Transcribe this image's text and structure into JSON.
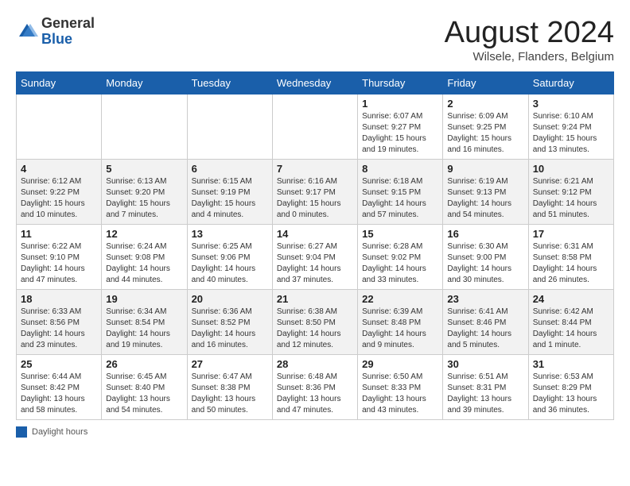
{
  "header": {
    "logo_general": "General",
    "logo_blue": "Blue",
    "month_title": "August 2024",
    "location": "Wilsele, Flanders, Belgium"
  },
  "weekdays": [
    "Sunday",
    "Monday",
    "Tuesday",
    "Wednesday",
    "Thursday",
    "Friday",
    "Saturday"
  ],
  "footer": {
    "label": "Daylight hours"
  },
  "weeks": [
    [
      {
        "day": "",
        "info": ""
      },
      {
        "day": "",
        "info": ""
      },
      {
        "day": "",
        "info": ""
      },
      {
        "day": "",
        "info": ""
      },
      {
        "day": "1",
        "info": "Sunrise: 6:07 AM\nSunset: 9:27 PM\nDaylight: 15 hours\nand 19 minutes."
      },
      {
        "day": "2",
        "info": "Sunrise: 6:09 AM\nSunset: 9:25 PM\nDaylight: 15 hours\nand 16 minutes."
      },
      {
        "day": "3",
        "info": "Sunrise: 6:10 AM\nSunset: 9:24 PM\nDaylight: 15 hours\nand 13 minutes."
      }
    ],
    [
      {
        "day": "4",
        "info": "Sunrise: 6:12 AM\nSunset: 9:22 PM\nDaylight: 15 hours\nand 10 minutes."
      },
      {
        "day": "5",
        "info": "Sunrise: 6:13 AM\nSunset: 9:20 PM\nDaylight: 15 hours\nand 7 minutes."
      },
      {
        "day": "6",
        "info": "Sunrise: 6:15 AM\nSunset: 9:19 PM\nDaylight: 15 hours\nand 4 minutes."
      },
      {
        "day": "7",
        "info": "Sunrise: 6:16 AM\nSunset: 9:17 PM\nDaylight: 15 hours\nand 0 minutes."
      },
      {
        "day": "8",
        "info": "Sunrise: 6:18 AM\nSunset: 9:15 PM\nDaylight: 14 hours\nand 57 minutes."
      },
      {
        "day": "9",
        "info": "Sunrise: 6:19 AM\nSunset: 9:13 PM\nDaylight: 14 hours\nand 54 minutes."
      },
      {
        "day": "10",
        "info": "Sunrise: 6:21 AM\nSunset: 9:12 PM\nDaylight: 14 hours\nand 51 minutes."
      }
    ],
    [
      {
        "day": "11",
        "info": "Sunrise: 6:22 AM\nSunset: 9:10 PM\nDaylight: 14 hours\nand 47 minutes."
      },
      {
        "day": "12",
        "info": "Sunrise: 6:24 AM\nSunset: 9:08 PM\nDaylight: 14 hours\nand 44 minutes."
      },
      {
        "day": "13",
        "info": "Sunrise: 6:25 AM\nSunset: 9:06 PM\nDaylight: 14 hours\nand 40 minutes."
      },
      {
        "day": "14",
        "info": "Sunrise: 6:27 AM\nSunset: 9:04 PM\nDaylight: 14 hours\nand 37 minutes."
      },
      {
        "day": "15",
        "info": "Sunrise: 6:28 AM\nSunset: 9:02 PM\nDaylight: 14 hours\nand 33 minutes."
      },
      {
        "day": "16",
        "info": "Sunrise: 6:30 AM\nSunset: 9:00 PM\nDaylight: 14 hours\nand 30 minutes."
      },
      {
        "day": "17",
        "info": "Sunrise: 6:31 AM\nSunset: 8:58 PM\nDaylight: 14 hours\nand 26 minutes."
      }
    ],
    [
      {
        "day": "18",
        "info": "Sunrise: 6:33 AM\nSunset: 8:56 PM\nDaylight: 14 hours\nand 23 minutes."
      },
      {
        "day": "19",
        "info": "Sunrise: 6:34 AM\nSunset: 8:54 PM\nDaylight: 14 hours\nand 19 minutes."
      },
      {
        "day": "20",
        "info": "Sunrise: 6:36 AM\nSunset: 8:52 PM\nDaylight: 14 hours\nand 16 minutes."
      },
      {
        "day": "21",
        "info": "Sunrise: 6:38 AM\nSunset: 8:50 PM\nDaylight: 14 hours\nand 12 minutes."
      },
      {
        "day": "22",
        "info": "Sunrise: 6:39 AM\nSunset: 8:48 PM\nDaylight: 14 hours\nand 9 minutes."
      },
      {
        "day": "23",
        "info": "Sunrise: 6:41 AM\nSunset: 8:46 PM\nDaylight: 14 hours\nand 5 minutes."
      },
      {
        "day": "24",
        "info": "Sunrise: 6:42 AM\nSunset: 8:44 PM\nDaylight: 14 hours\nand 1 minute."
      }
    ],
    [
      {
        "day": "25",
        "info": "Sunrise: 6:44 AM\nSunset: 8:42 PM\nDaylight: 13 hours\nand 58 minutes."
      },
      {
        "day": "26",
        "info": "Sunrise: 6:45 AM\nSunset: 8:40 PM\nDaylight: 13 hours\nand 54 minutes."
      },
      {
        "day": "27",
        "info": "Sunrise: 6:47 AM\nSunset: 8:38 PM\nDaylight: 13 hours\nand 50 minutes."
      },
      {
        "day": "28",
        "info": "Sunrise: 6:48 AM\nSunset: 8:36 PM\nDaylight: 13 hours\nand 47 minutes."
      },
      {
        "day": "29",
        "info": "Sunrise: 6:50 AM\nSunset: 8:33 PM\nDaylight: 13 hours\nand 43 minutes."
      },
      {
        "day": "30",
        "info": "Sunrise: 6:51 AM\nSunset: 8:31 PM\nDaylight: 13 hours\nand 39 minutes."
      },
      {
        "day": "31",
        "info": "Sunrise: 6:53 AM\nSunset: 8:29 PM\nDaylight: 13 hours\nand 36 minutes."
      }
    ]
  ]
}
